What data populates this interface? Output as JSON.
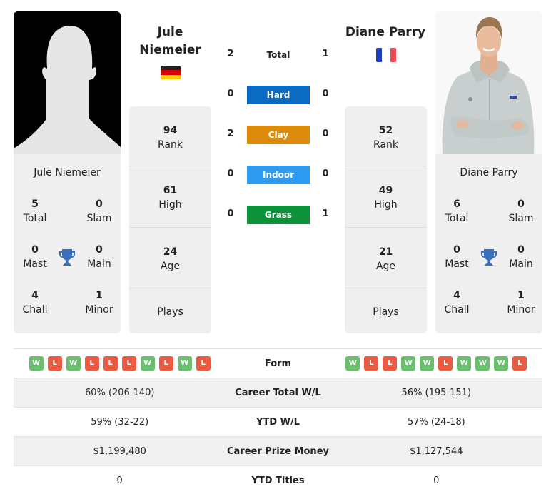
{
  "player1": {
    "name": "Jule Niemeier",
    "name_line1": "Jule",
    "name_line2": "Niemeier",
    "flag": "germany-flag",
    "flag_colors": [
      "#000000",
      "#dd0000",
      "#ffce00"
    ],
    "titles": {
      "total": {
        "value": "5",
        "label": "Total"
      },
      "slam": {
        "value": "0",
        "label": "Slam"
      },
      "mast": {
        "value": "0",
        "label": "Mast"
      },
      "main": {
        "value": "0",
        "label": "Main"
      },
      "chall": {
        "value": "4",
        "label": "Chall"
      },
      "minor": {
        "value": "1",
        "label": "Minor"
      }
    },
    "stats": {
      "rank": {
        "value": "94",
        "label": "Rank"
      },
      "high": {
        "value": "61",
        "label": "High"
      },
      "age": {
        "value": "24",
        "label": "Age"
      },
      "plays": {
        "value": "",
        "label": "Plays"
      }
    },
    "h2h": {
      "total": "2",
      "hard": "0",
      "clay": "2",
      "indoor": "0",
      "grass": "0"
    },
    "form": [
      "W",
      "L",
      "W",
      "L",
      "L",
      "L",
      "W",
      "L",
      "W",
      "L"
    ],
    "career_wl": "60% (206-140)",
    "ytd_wl": "59% (32-22)",
    "prize_money": "$1,199,480",
    "ytd_titles": "0"
  },
  "player2": {
    "name": "Diane Parry",
    "flag": "france-flag",
    "flag_colors": [
      "#1e3fbf",
      "#ffffff",
      "#f04a55"
    ],
    "titles": {
      "total": {
        "value": "6",
        "label": "Total"
      },
      "slam": {
        "value": "0",
        "label": "Slam"
      },
      "mast": {
        "value": "0",
        "label": "Mast"
      },
      "main": {
        "value": "0",
        "label": "Main"
      },
      "chall": {
        "value": "4",
        "label": "Chall"
      },
      "minor": {
        "value": "1",
        "label": "Minor"
      }
    },
    "stats": {
      "rank": {
        "value": "52",
        "label": "Rank"
      },
      "high": {
        "value": "49",
        "label": "High"
      },
      "age": {
        "value": "21",
        "label": "Age"
      },
      "plays": {
        "value": "",
        "label": "Plays"
      }
    },
    "h2h": {
      "total": "1",
      "hard": "0",
      "clay": "0",
      "indoor": "0",
      "grass": "1"
    },
    "form": [
      "W",
      "L",
      "L",
      "W",
      "W",
      "L",
      "W",
      "W",
      "W",
      "L"
    ],
    "career_wl": "56% (195-151)",
    "ytd_wl": "57% (24-18)",
    "prize_money": "$1,127,544",
    "ytd_titles": "0"
  },
  "surfaces": {
    "total": {
      "label": "Total"
    },
    "hard": {
      "label": "Hard",
      "color": "#0a6bc1"
    },
    "clay": {
      "label": "Clay",
      "color": "#dc8b0a"
    },
    "indoor": {
      "label": "Indoor",
      "color": "#2f9bf0"
    },
    "grass": {
      "label": "Grass",
      "color": "#0d923a"
    }
  },
  "table": {
    "form_label": "Form",
    "career_wl_label": "Career Total W/L",
    "ytd_wl_label": "YTD W/L",
    "prize_label": "Career Prize Money",
    "ytd_titles_label": "YTD Titles"
  },
  "colors": {
    "win": "#6abf6e",
    "loss": "#ea5b43",
    "trophy": "#3a6fbf",
    "card_bg": "#efefef"
  }
}
